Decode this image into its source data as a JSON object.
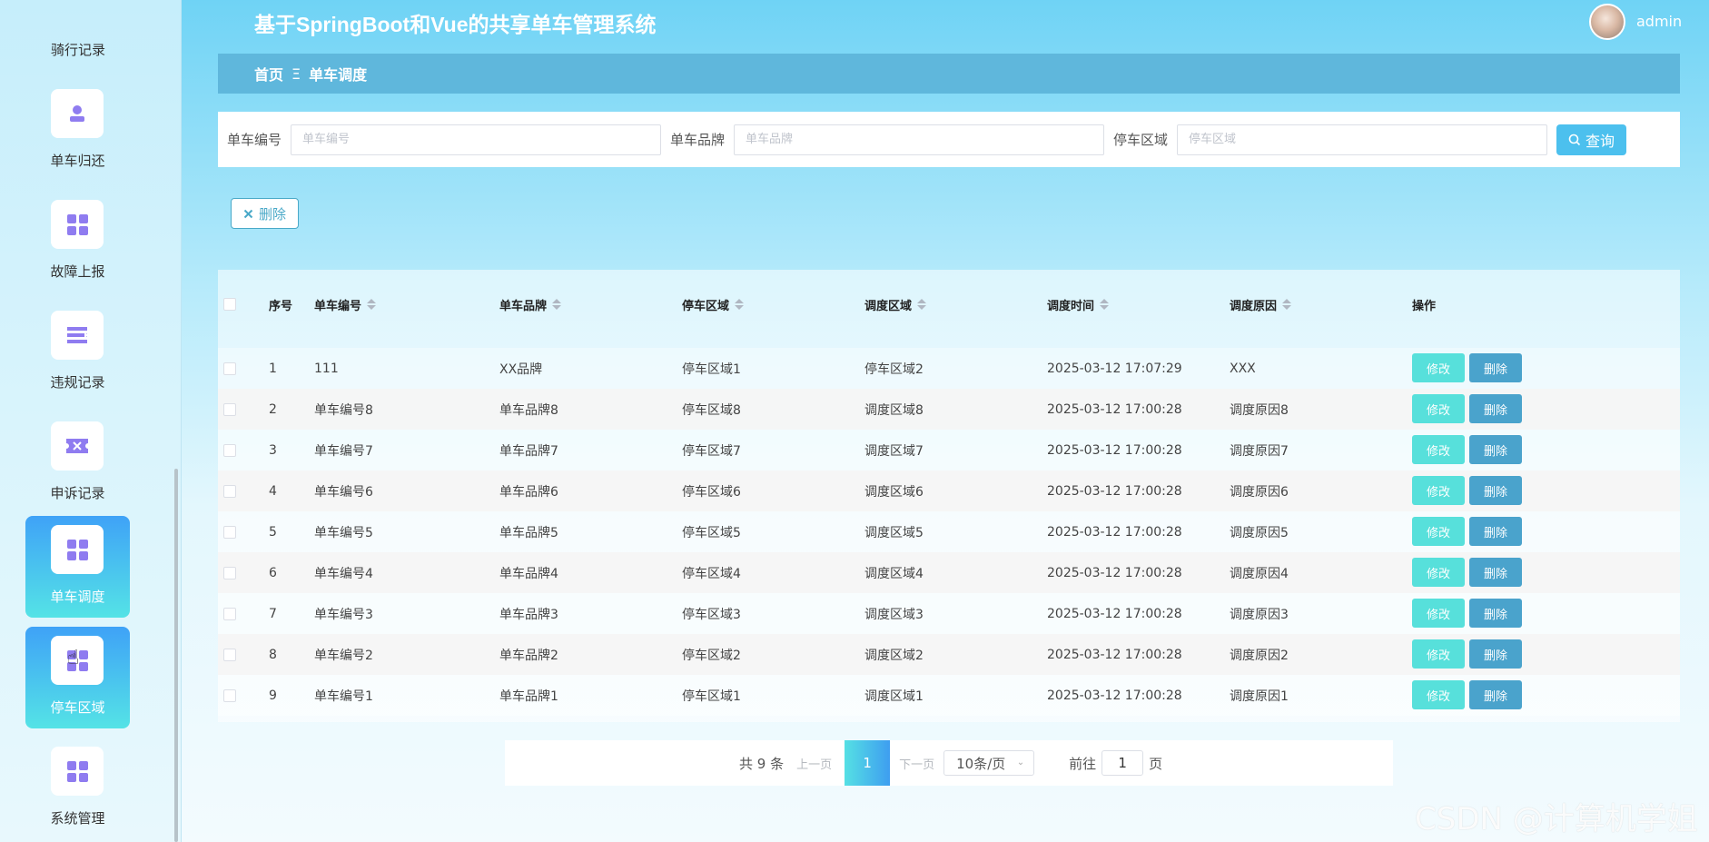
{
  "header": {
    "title": "基于SpringBoot和Vue的共享单车管理系统",
    "username": "admin"
  },
  "breadcrumb": {
    "home": "首页",
    "separator": "Ξ",
    "current": "单车调度"
  },
  "sidebar": {
    "top_partial_label": "骑行记录",
    "items": [
      {
        "label": "单车归还",
        "icon": "user-icon",
        "active": false
      },
      {
        "label": "故障上报",
        "icon": "grid-icon",
        "active": false
      },
      {
        "label": "违规记录",
        "icon": "list-icon",
        "active": false
      },
      {
        "label": "申诉记录",
        "icon": "ticket-icon",
        "active": false
      },
      {
        "label": "单车调度",
        "icon": "grid-icon",
        "active": true
      },
      {
        "label": "停车区域",
        "icon": "grid-icon",
        "active": true
      },
      {
        "label": "系统管理",
        "icon": "grid-icon",
        "active": false
      }
    ]
  },
  "search": {
    "bike_no_label": "单车编号",
    "bike_no_placeholder": "单车编号",
    "brand_label": "单车品牌",
    "brand_placeholder": "单车品牌",
    "area_label": "停车区域",
    "area_placeholder": "停车区域",
    "query_button": "查询"
  },
  "toolbar": {
    "delete_button": "删除"
  },
  "table": {
    "headers": {
      "index": "序号",
      "bike_no": "单车编号",
      "brand": "单车品牌",
      "park_area": "停车区域",
      "dispatch_area": "调度区域",
      "dispatch_time": "调度时间",
      "reason": "调度原因",
      "actions": "操作"
    },
    "edit_label": "修改",
    "delete_label": "删除",
    "rows": [
      {
        "index": "1",
        "bike_no": "111",
        "brand": "XX品牌",
        "park_area": "停车区域1",
        "dispatch_area": "停车区域2",
        "dispatch_time": "2025-03-12 17:07:29",
        "reason": "XXX"
      },
      {
        "index": "2",
        "bike_no": "单车编号8",
        "brand": "单车品牌8",
        "park_area": "停车区域8",
        "dispatch_area": "调度区域8",
        "dispatch_time": "2025-03-12 17:00:28",
        "reason": "调度原因8"
      },
      {
        "index": "3",
        "bike_no": "单车编号7",
        "brand": "单车品牌7",
        "park_area": "停车区域7",
        "dispatch_area": "调度区域7",
        "dispatch_time": "2025-03-12 17:00:28",
        "reason": "调度原因7"
      },
      {
        "index": "4",
        "bike_no": "单车编号6",
        "brand": "单车品牌6",
        "park_area": "停车区域6",
        "dispatch_area": "调度区域6",
        "dispatch_time": "2025-03-12 17:00:28",
        "reason": "调度原因6"
      },
      {
        "index": "5",
        "bike_no": "单车编号5",
        "brand": "单车品牌5",
        "park_area": "停车区域5",
        "dispatch_area": "调度区域5",
        "dispatch_time": "2025-03-12 17:00:28",
        "reason": "调度原因5"
      },
      {
        "index": "6",
        "bike_no": "单车编号4",
        "brand": "单车品牌4",
        "park_area": "停车区域4",
        "dispatch_area": "调度区域4",
        "dispatch_time": "2025-03-12 17:00:28",
        "reason": "调度原因4"
      },
      {
        "index": "7",
        "bike_no": "单车编号3",
        "brand": "单车品牌3",
        "park_area": "停车区域3",
        "dispatch_area": "调度区域3",
        "dispatch_time": "2025-03-12 17:00:28",
        "reason": "调度原因3"
      },
      {
        "index": "8",
        "bike_no": "单车编号2",
        "brand": "单车品牌2",
        "park_area": "停车区域2",
        "dispatch_area": "调度区域2",
        "dispatch_time": "2025-03-12 17:00:28",
        "reason": "调度原因2"
      },
      {
        "index": "9",
        "bike_no": "单车编号1",
        "brand": "单车品牌1",
        "park_area": "停车区域1",
        "dispatch_area": "调度区域1",
        "dispatch_time": "2025-03-12 17:00:28",
        "reason": "调度原因1"
      }
    ]
  },
  "pagination": {
    "total": "共 9 条",
    "prev": "上一页",
    "current_page": "1",
    "next": "下一页",
    "page_size": "10条/页",
    "goto_label": "前往",
    "goto_value": "1",
    "page_suffix": "页"
  },
  "watermark": "CSDN @计算机学姐"
}
